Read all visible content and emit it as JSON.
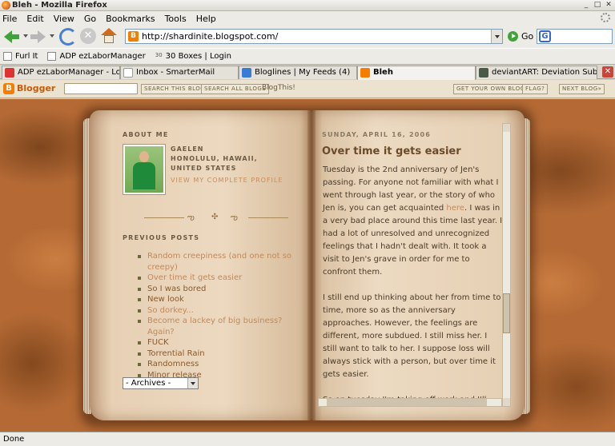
{
  "window": {
    "title": "Bleh - Mozilla Firefox"
  },
  "menu": [
    "File",
    "Edit",
    "View",
    "Go",
    "Bookmarks",
    "Tools",
    "Help"
  ],
  "nav": {
    "url": "http://shardinite.blogspot.com/",
    "go_label": "Go"
  },
  "bookmarks": [
    "Furl It",
    "ADP ezLaborManager",
    "30 Boxes | Login"
  ],
  "tabs": [
    {
      "label": "ADP ezLaborManager - Login"
    },
    {
      "label": "Inbox - SmarterMail"
    },
    {
      "label": "Bloglines | My Feeds (4)"
    },
    {
      "label": "Bleh"
    },
    {
      "label": "deviantART: Deviation Submissi..."
    }
  ],
  "blogger_bar": {
    "logo": "Blogger",
    "search_this": "SEARCH THIS BLOG",
    "search_all": "SEARCH ALL BLOGS",
    "blogthis": "BlogThis!",
    "get_own": "GET YOUR OWN BLOG",
    "flag": "FLAG?",
    "next": "NEXT BLOG»"
  },
  "sidebar": {
    "about_heading": "ABOUT ME",
    "name": "GAELEN",
    "location": "HONOLULU, HAWAII, UNITED STATES",
    "profile_link": "VIEW MY COMPLETE PROFILE",
    "previous_heading": "PREVIOUS POSTS",
    "posts": [
      "Random creepiness (and one not so creepy)",
      "Over time it gets easier",
      "So I was bored",
      "New look",
      "So dorkey...",
      "Become a lackey of big business? Again?",
      "FUCK",
      "Torrential Rain",
      "Randomness",
      "Minor release"
    ],
    "archives": "- Archives -"
  },
  "post": {
    "date": "SUNDAY, APRIL 16, 2006",
    "title": "Over time it gets easier",
    "p1_before": "Tuesday is the 2nd anniversary of Jen's passing. For anyone not familiar with what I went through last year, or the story of who Jen is, you can get acquainted ",
    "p1_link": "here",
    "p1_after": ". I was in a very bad place around this time last year. I had a lot of unresolved and unrecognized feelings that I hadn't dealt with. It took a visit to Jen's grave in order for me to confront them.",
    "p2": "I still end up thinking about her from time to time, more so as the anniversary approaches. However, the feelings are different, more subdued. I still miss her. I still want to talk to her. I suppose loss will always stick with a person, but over time it gets easier.",
    "p3": "So on tuesday I'm taking off work and I'll make the trip out to Kahuluu. Sometimes I wish I could visit her more than once a year, at times when I really"
  },
  "status": "Done"
}
